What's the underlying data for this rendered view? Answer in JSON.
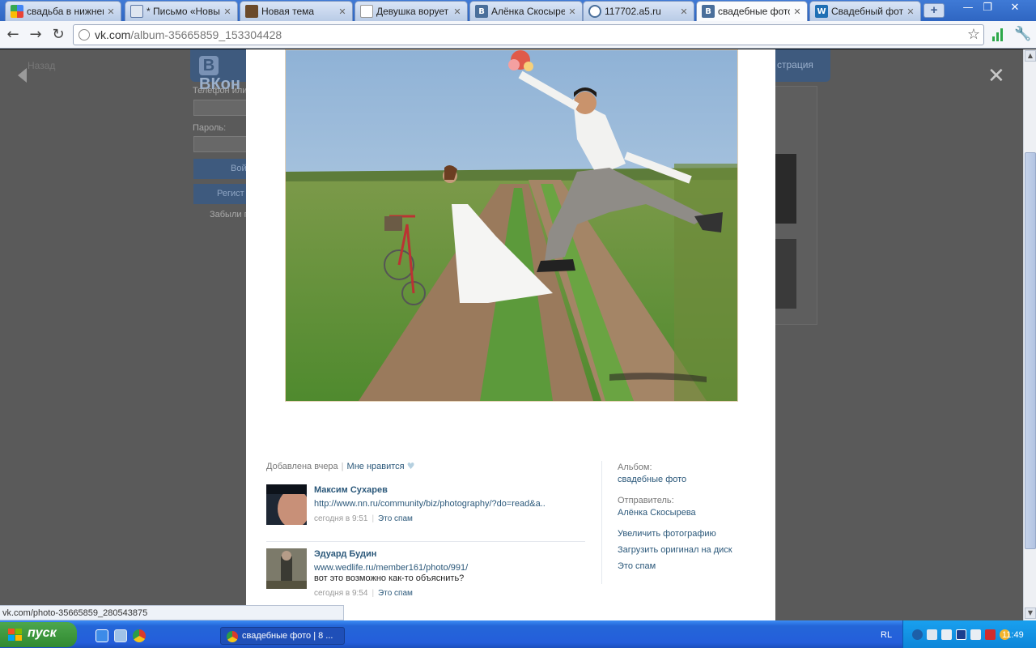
{
  "browser": {
    "tabs": [
      {
        "title": "свадьба в нижнем",
        "icon": "google-icon"
      },
      {
        "title": "* Письмо «Новый г",
        "icon": "mail-icon"
      },
      {
        "title": "Новая тема",
        "icon": "forum-icon"
      },
      {
        "title": "Девушка ворует ф",
        "icon": "page-icon"
      },
      {
        "title": "Алёнка Скосырева",
        "icon": "vk-icon"
      },
      {
        "title": "117702.a5.ru",
        "icon": "globe-icon"
      },
      {
        "title": "свадебные фото |",
        "icon": "vk-icon",
        "active": true
      },
      {
        "title": "Свадебный фотог",
        "icon": "wedlife-icon"
      }
    ],
    "new_tab": "+",
    "url_host": "vk.com",
    "url_path": "/album-35665859_153304428",
    "status_url": "vk.com/photo-35665859_280543875"
  },
  "background_page": {
    "logo": "ВКон",
    "logo_badge": "В",
    "registration": "страция",
    "phone_label": "Телефон или",
    "password_label": "Пароль:",
    "login_button": "Вой",
    "register_button": "Регист",
    "forgot": "Забыли г",
    "back_label": "Назад"
  },
  "photo_viewer": {
    "added": "Добавлена вчера",
    "like": "Мне нравится",
    "comments": [
      {
        "author": "Максим Сухарев",
        "link": "http://www.nn.ru/community/biz/photography/?do=read&a..",
        "text": "",
        "time": "сегодня в 9:51",
        "spam": "Это спам"
      },
      {
        "author": "Эдуард Будин",
        "link": "www.wedlife.ru/member161/photo/991/",
        "text": "вот это возможно как-то объяснить?",
        "time": "сегодня в 9:54",
        "spam": "Это спам"
      }
    ],
    "album_label": "Альбом:",
    "album_name": "свадебные фото",
    "sender_label": "Отправитель:",
    "sender_name": "Алёнка Скосырева",
    "actions": [
      "Увеличить фотографию",
      "Загрузить оригинал на диск",
      "Это спам"
    ]
  },
  "taskbar": {
    "start": "пуск",
    "task_item": "свадебные фото | 8 ...",
    "lang": "RL",
    "clock": "11:49"
  },
  "colors": {
    "vk_link": "#2b587a",
    "taskbar_blue": "#245edb",
    "start_green": "#318a31"
  }
}
